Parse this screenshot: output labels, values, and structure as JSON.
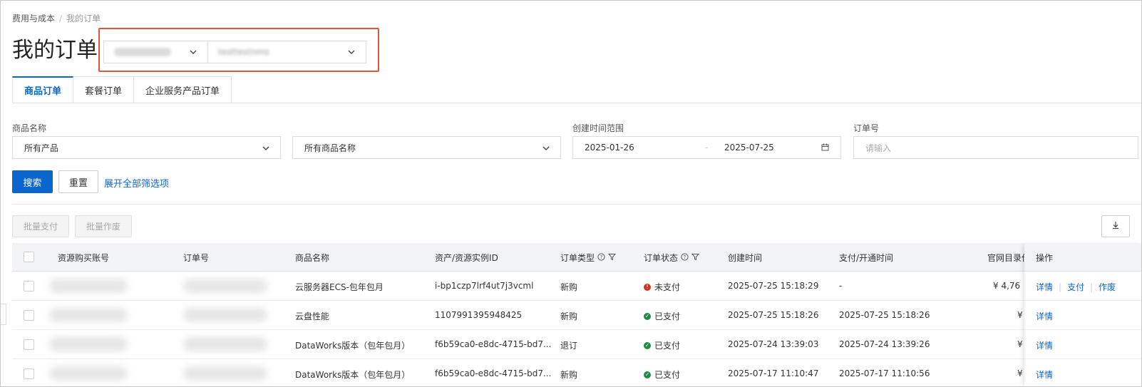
{
  "breadcrumb": {
    "parent": "费用与成本",
    "separator": "/",
    "current": "我的订单"
  },
  "page_title": "我的订单",
  "account_selector": {
    "account_value": "",
    "user_value": "testtestnms"
  },
  "tabs": [
    {
      "label": "商品订单",
      "active": true
    },
    {
      "label": "套餐订单",
      "active": false
    },
    {
      "label": "企业服务产品订单",
      "active": false
    }
  ],
  "filters": {
    "product_name_label": "商品名称",
    "product_select_value": "所有产品",
    "product_name_select_value": "所有商品名称",
    "date_range_label": "创建时间范围",
    "date_start": "2025-01-26",
    "date_end": "2025-07-25",
    "order_no_label": "订单号",
    "order_no_placeholder": "请输入"
  },
  "actions": {
    "search": "搜索",
    "reset": "重置",
    "expand_filters": "展开全部筛选项",
    "batch_pay": "批量支付",
    "batch_void": "批量作废"
  },
  "table": {
    "columns": {
      "buyer_account": "资源购买账号",
      "order_no": "订单号",
      "product_name": "商品名称",
      "instance_id": "资产/资源实例ID",
      "order_type": "订单类型",
      "order_status": "订单状态",
      "created_time": "创建时间",
      "paid_time": "支付/开通时间",
      "list_price": "官网目录价",
      "operation": "操作"
    },
    "rows": [
      {
        "product_name": "云服务器ECS-包年包月",
        "instance_id": "i-bp1czp7lrf4ut7j3vcml",
        "order_type": "新购",
        "status": "未支付",
        "status_color": "#d93026",
        "created_time": "2025-07-25 15:18:29",
        "paid_time": "-",
        "price": "¥ 4,76"
      },
      {
        "product_name": "云盘性能",
        "instance_id": "1107991395948425",
        "order_type": "新购",
        "status": "已支付",
        "status_color": "#1e8e3e",
        "created_time": "2025-07-25 15:18:26",
        "paid_time": "2025-07-25 15:18:26",
        "price": "¥"
      },
      {
        "product_name": "DataWorks版本（包年包月）",
        "instance_id": "f6b59ca0-e8dc-4715-bd7...",
        "order_type": "退订",
        "status": "已支付",
        "status_color": "#1e8e3e",
        "created_time": "2025-07-24 13:39:03",
        "paid_time": "2025-07-24 13:39:26",
        "price": "¥"
      },
      {
        "product_name": "DataWorks版本（包年包月）",
        "instance_id": "f6b59ca0-e8dc-4715-bd7...",
        "order_type": "新购",
        "status": "已支付",
        "status_color": "#1e8e3e",
        "created_time": "2025-07-17 11:10:47",
        "paid_time": "2025-07-17 11:10:56",
        "price": "¥"
      }
    ],
    "row_actions": {
      "detail": "详情",
      "pay": "支付",
      "void": "作废"
    }
  }
}
